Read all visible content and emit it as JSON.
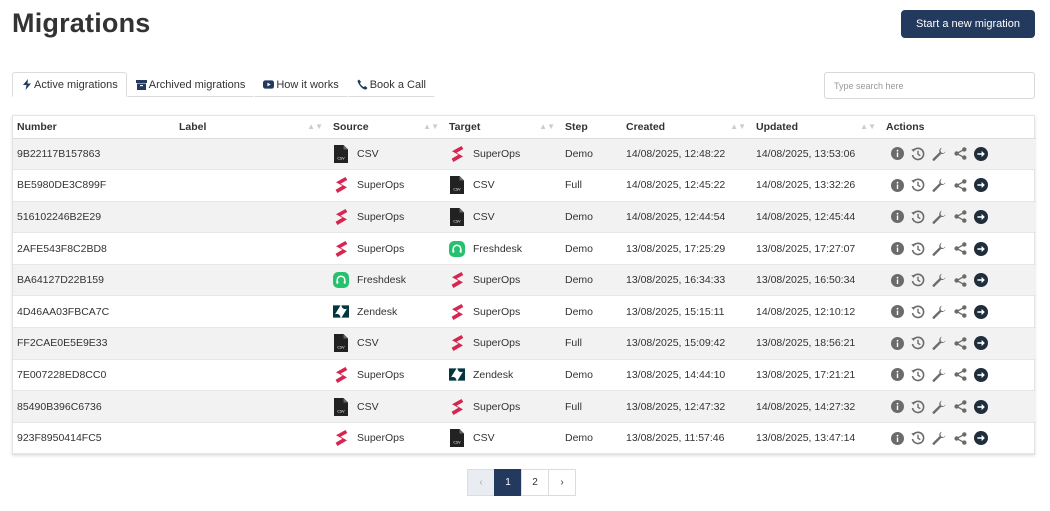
{
  "header": {
    "title": "Migrations",
    "new_button": "Start a new migration"
  },
  "tabs": [
    {
      "label": "Active migrations",
      "icon": "bolt-icon"
    },
    {
      "label": "Archived migrations",
      "icon": "archive-icon"
    },
    {
      "label": "How it works",
      "icon": "youtube-icon"
    },
    {
      "label": "Book a Call",
      "icon": "phone-icon"
    }
  ],
  "search": {
    "placeholder": "Type search here",
    "value": ""
  },
  "table": {
    "columns": [
      "Number",
      "Label",
      "Source",
      "Target",
      "Step",
      "Created",
      "Updated",
      "Actions"
    ],
    "rows": [
      {
        "number": "9B22117B157863",
        "label": "",
        "source": "CSV",
        "target": "SuperOps",
        "step": "Demo",
        "created": "14/08/2025, 12:48:22",
        "updated": "14/08/2025, 13:53:06"
      },
      {
        "number": "BE5980DE3C899F",
        "label": "",
        "source": "SuperOps",
        "target": "CSV",
        "step": "Full",
        "created": "14/08/2025, 12:45:22",
        "updated": "14/08/2025, 13:32:26"
      },
      {
        "number": "516102246B2E29",
        "label": "",
        "source": "SuperOps",
        "target": "CSV",
        "step": "Demo",
        "created": "14/08/2025, 12:44:54",
        "updated": "14/08/2025, 12:45:44"
      },
      {
        "number": "2AFE543F8C2BD8",
        "label": "",
        "source": "SuperOps",
        "target": "Freshdesk",
        "step": "Demo",
        "created": "13/08/2025, 17:25:29",
        "updated": "13/08/2025, 17:27:07"
      },
      {
        "number": "BA64127D22B159",
        "label": "",
        "source": "Freshdesk",
        "target": "SuperOps",
        "step": "Demo",
        "created": "13/08/2025, 16:34:33",
        "updated": "13/08/2025, 16:50:34"
      },
      {
        "number": "4D46AA03FBCA7C",
        "label": "",
        "source": "Zendesk",
        "target": "SuperOps",
        "step": "Demo",
        "created": "13/08/2025, 15:15:11",
        "updated": "14/08/2025, 12:10:12"
      },
      {
        "number": "FF2CAE0E5E9E33",
        "label": "",
        "source": "CSV",
        "target": "SuperOps",
        "step": "Full",
        "created": "13/08/2025, 15:09:42",
        "updated": "13/08/2025, 18:56:21"
      },
      {
        "number": "7E007228ED8CC0",
        "label": "",
        "source": "SuperOps",
        "target": "Zendesk",
        "step": "Demo",
        "created": "13/08/2025, 14:44:10",
        "updated": "13/08/2025, 17:21:21"
      },
      {
        "number": "85490B396C6736",
        "label": "",
        "source": "CSV",
        "target": "SuperOps",
        "step": "Full",
        "created": "13/08/2025, 12:47:32",
        "updated": "14/08/2025, 14:27:32"
      },
      {
        "number": "923F8950414FC5",
        "label": "",
        "source": "SuperOps",
        "target": "CSV",
        "step": "Demo",
        "created": "13/08/2025, 11:57:46",
        "updated": "13/08/2025, 13:47:14"
      }
    ],
    "actions": [
      "info-icon",
      "history-icon",
      "wrench-icon",
      "share-icon",
      "arrow-right-circle-icon"
    ]
  },
  "pagination": {
    "prev": "‹",
    "pages": [
      "1",
      "2"
    ],
    "current": "1",
    "next": "›"
  },
  "colors": {
    "primary": "#23395d",
    "superops": "#d6254f",
    "freshdesk": "#25c16f",
    "zendesk": "#03363d",
    "csv": "#222222"
  }
}
